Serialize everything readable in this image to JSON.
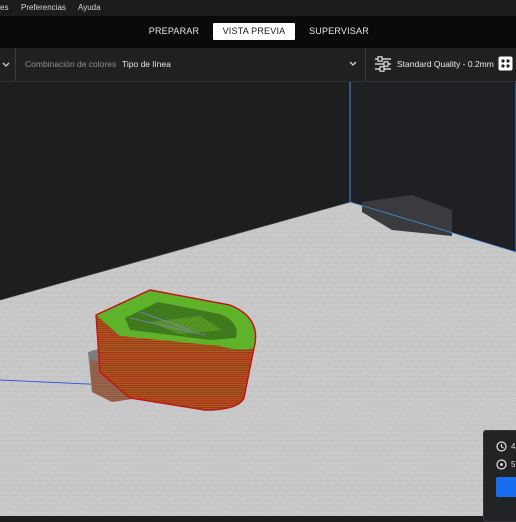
{
  "menu": {
    "items": [
      "es",
      "Preferencias",
      "Ayuda"
    ]
  },
  "stages": [
    {
      "label": "PREPARAR",
      "active": false
    },
    {
      "label": "VISTA PREVIA",
      "active": true
    },
    {
      "label": "SUPERVISAR",
      "active": false
    }
  ],
  "toolbar": {
    "color_scheme_label": "Combinación de colores",
    "color_scheme_value": "Tipo de línea",
    "profile": "Standard Quality - 0.2mm"
  },
  "print_panel": {
    "time_partial": "4",
    "material_partial": "5"
  },
  "colors": {
    "accent": "#196ef0",
    "build_plate": "#c7c7c7",
    "wall_outer": "#d11a1a",
    "wall_inner": "#5fb32a",
    "support": "#8a8a8a"
  }
}
